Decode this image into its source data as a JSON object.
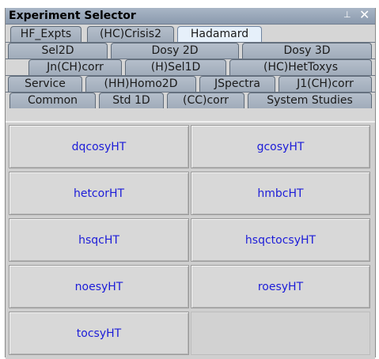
{
  "window": {
    "title": "Experiment Selector",
    "pin_glyph": "⊥",
    "close_glyph": "✕",
    "icons": [
      "pin-icon",
      "close-icon"
    ]
  },
  "tabs": {
    "rows": [
      [
        "HF_Expts",
        "(HC)Crisis2",
        "Hadamard"
      ],
      [
        "Sel2D",
        "Dosy 2D",
        "Dosy 3D"
      ],
      [
        "Jn(CH)corr",
        "(H)Sel1D",
        "(HC)HetToxys"
      ],
      [
        "Service",
        "(HH)Homo2D",
        "JSpectra",
        "J1(CH)corr"
      ],
      [
        "Common",
        "Std 1D",
        "(CC)corr",
        "System Studies"
      ]
    ],
    "selected": "Hadamard"
  },
  "experiments": [
    "dqcosyHT",
    "gcosyHT",
    "hetcorHT",
    "hmbcHT",
    "hsqcHT",
    "hsqctocsyHT",
    "noesyHT",
    "roesyHT",
    "tocsyHT"
  ],
  "colors": {
    "button_text": "#1c1cd8",
    "tab_bg": "#a6b2c0",
    "selected_tab_bg": "#e6f0fa",
    "title_bar": "#9aa8ba"
  }
}
